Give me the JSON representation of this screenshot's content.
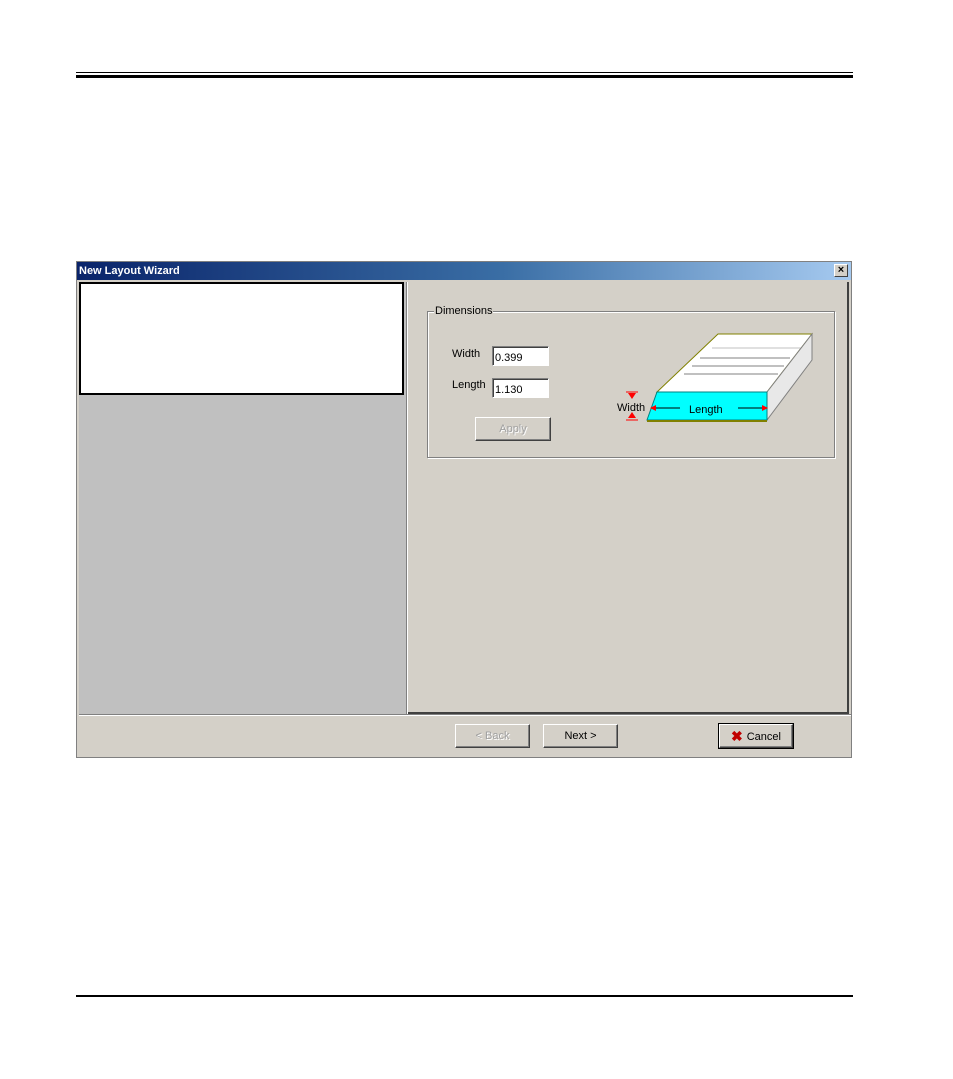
{
  "window": {
    "title": "New Layout Wizard",
    "close_glyph": "×"
  },
  "dimensions": {
    "group_label": "Dimensions",
    "width_label": "Width",
    "width_value": "0.399",
    "length_label": "Length",
    "length_value": "1.130",
    "apply_label": "Apply"
  },
  "diagram": {
    "width_label": "Width",
    "length_label": "Length",
    "highlight_color": "#00ffff",
    "arrow_color": "#ff0000"
  },
  "buttons": {
    "back_label": "< Back",
    "next_label": "Next >",
    "cancel_label": "Cancel",
    "cancel_icon": "red-x-icon"
  }
}
